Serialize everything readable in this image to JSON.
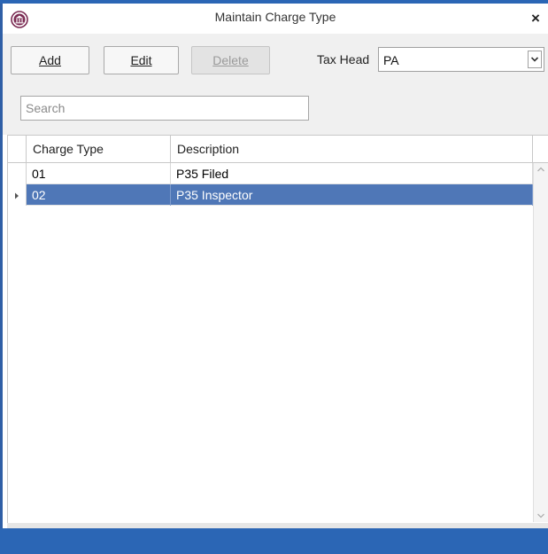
{
  "window": {
    "title": "Maintain Charge Type",
    "close_label": "×",
    "accent_color": "#2b66b5"
  },
  "toolbar": {
    "add_label": "Add",
    "edit_label": "Edit",
    "delete_label": "Delete",
    "tax_head_label": "Tax Head",
    "tax_head_value": "PA"
  },
  "search": {
    "placeholder": "Search",
    "value": ""
  },
  "grid": {
    "columns": [
      "Charge Type",
      "Description"
    ],
    "rows": [
      {
        "charge_type": "01",
        "description": "P35 Filed",
        "selected": false
      },
      {
        "charge_type": "02",
        "description": "P35 Inspector",
        "selected": true
      }
    ],
    "selected_row_color": "#4f77b7"
  }
}
